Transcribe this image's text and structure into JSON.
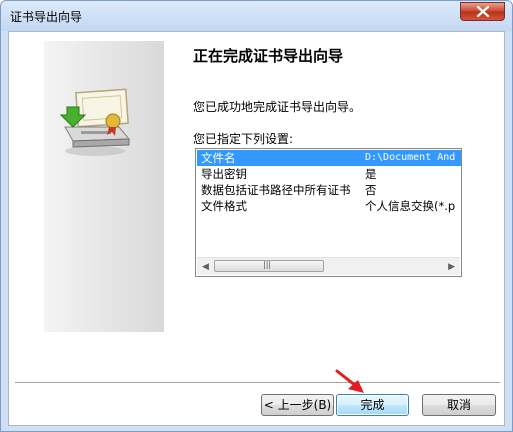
{
  "window": {
    "title": "证书导出向导"
  },
  "page": {
    "heading": "正在完成证书导出向导",
    "description": "您已成功地完成证书导出向导。",
    "specified_label": "您已指定下列设置:"
  },
  "settings": {
    "rows": [
      {
        "key": "文件名",
        "value": "D:\\Document And"
      },
      {
        "key": "导出密钥",
        "value": "是"
      },
      {
        "key": "数据包括证书路径中所有证书",
        "value": "否"
      },
      {
        "key": "文件格式",
        "value": "个人信息交换(*.p"
      }
    ],
    "selected_index": 0,
    "scroll_left": "◀",
    "scroll_right": "▶",
    "scroll_grip": "|||"
  },
  "buttons": {
    "back": "< 上一步(B)",
    "finish": "完成",
    "cancel": "取消"
  },
  "colors": {
    "selection": "#3399ff",
    "title_gradient": "#c4d8f1",
    "arrow_annotation": "#e02020"
  },
  "icons": [
    "close-icon",
    "certificate-export-icon",
    "scroll-left-arrow-icon",
    "scroll-right-arrow-icon",
    "red-pointer-arrow-icon"
  ]
}
